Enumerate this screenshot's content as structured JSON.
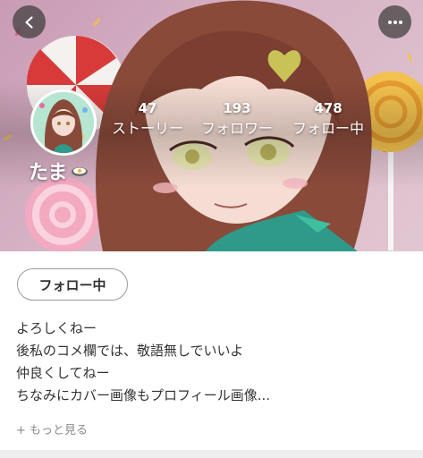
{
  "profile": {
    "username": "たま",
    "username_badge_icon": "egg-dish-icon",
    "stats": [
      {
        "value": "47",
        "label": "ストーリー"
      },
      {
        "value": "193",
        "label": "フォロワー"
      },
      {
        "value": "478",
        "label": "フォロー中"
      }
    ],
    "follow_button_label": "フォロー中"
  },
  "bio": {
    "lines": [
      "よろしくねー",
      "後私のコメ欄では、敬語無しでいいよ",
      "仲良くしてねー",
      "ちなみにカバー画像もプロフィール画像..."
    ],
    "more_label": "+ もっと見る"
  },
  "icons": {
    "back": "chevron-left-icon",
    "more": "more-horizontal-icon"
  },
  "colors": {
    "cover_background": "#d7b4c6",
    "hair": "#8a4a3a",
    "button_border": "#9a9a9a"
  }
}
